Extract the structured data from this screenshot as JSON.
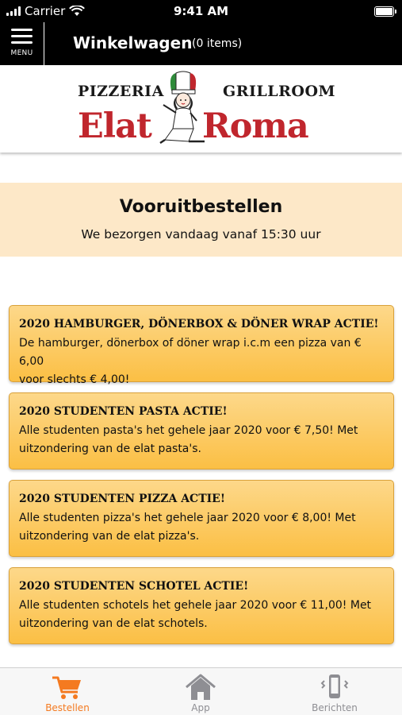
{
  "status_bar": {
    "carrier": "Carrier",
    "time": "9:41 AM"
  },
  "nav": {
    "menu_label": "MENU",
    "title": "Winkelwagen",
    "items_count": "(0 items)"
  },
  "logo": {
    "pizzeria": "PIZZERIA",
    "grillroom": "GRILLROOM",
    "elat": "Elat",
    "roma": "Roma"
  },
  "banner": {
    "title": "Vooruitbestellen",
    "subtitle": "We bezorgen vandaag vanaf 15:30 uur"
  },
  "promotions": [
    {
      "title": "2020 HAMBURGER, DÖNERBOX & DÖNER WRAP ACTIE!",
      "line1": "De hamburger, dönerbox of döner wrap i.c.m een pizza van € 6,00",
      "line2": "voor slechts € 4,00!"
    },
    {
      "title": "2020 STUDENTEN PASTA ACTIE!",
      "line1": "Alle studenten pasta's het gehele jaar 2020 voor € 7,50! Met",
      "line2": "uitzondering van de elat pasta's."
    },
    {
      "title": "2020 STUDENTEN PIZZA ACTIE!",
      "line1": "Alle studenten pizza's het gehele jaar 2020 voor € 8,00! Met",
      "line2": "uitzondering van de elat pizza's."
    },
    {
      "title": "2020 STUDENTEN SCHOTEL ACTIE!",
      "line1": "Alle studenten schotels het gehele jaar 2020 voor € 11,00! Met",
      "line2": "uitzondering van de elat schotels."
    }
  ],
  "tabs": [
    {
      "label": "Bestellen",
      "icon": "cart-icon",
      "active": true
    },
    {
      "label": "App",
      "icon": "home-icon",
      "active": false
    },
    {
      "label": "Berichten",
      "icon": "phone-vibrate-icon",
      "active": false
    }
  ],
  "colors": {
    "accent": "#f47a20",
    "tab_inactive": "#8e8e93",
    "banner_bg": "#fde8c8",
    "logo_red": "#c0262d",
    "promo_bg": "#fbbf44"
  }
}
